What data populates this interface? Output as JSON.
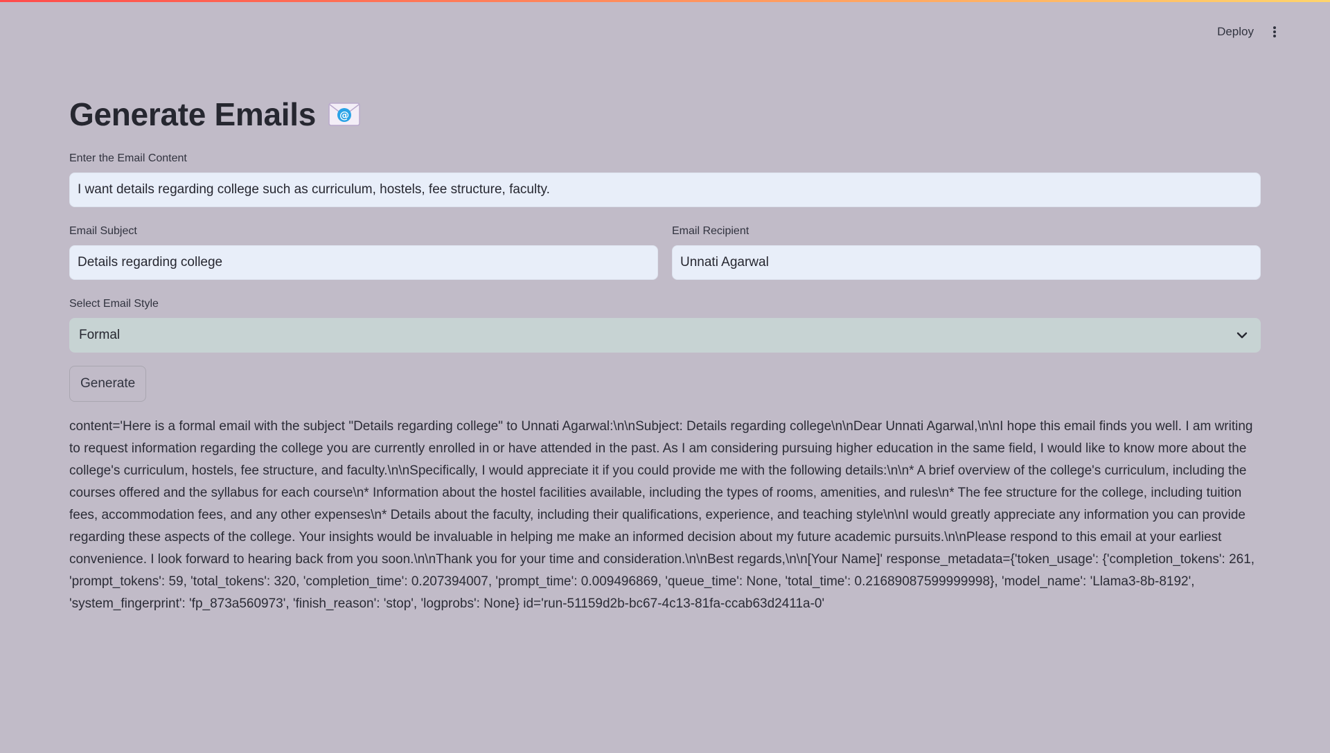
{
  "header": {
    "deploy_label": "Deploy",
    "menu_icon": "kebab-vertical-icon"
  },
  "page": {
    "title": "Generate Emails",
    "title_icon": "incoming-envelope-icon"
  },
  "form": {
    "content": {
      "label": "Enter the Email Content",
      "value": "I want details regarding college such as curriculum, hostels, fee structure, faculty."
    },
    "subject": {
      "label": "Email Subject",
      "value": "Details regarding college"
    },
    "recipient": {
      "label": "Email Recipient",
      "value": "Unnati Agarwal"
    },
    "style": {
      "label": "Select Email Style",
      "selected": "Formal"
    },
    "generate_label": "Generate"
  },
  "output": {
    "text": "content='Here is a formal email with the subject \"Details regarding college\" to Unnati Agarwal:\\n\\nSubject: Details regarding college\\n\\nDear Unnati Agarwal,\\n\\nI hope this email finds you well. I am writing to request information regarding the college you are currently enrolled in or have attended in the past. As I am considering pursuing higher education in the same field, I would like to know more about the college's curriculum, hostels, fee structure, and faculty.\\n\\nSpecifically, I would appreciate it if you could provide me with the following details:\\n\\n* A brief overview of the college's curriculum, including the courses offered and the syllabus for each course\\n* Information about the hostel facilities available, including the types of rooms, amenities, and rules\\n* The fee structure for the college, including tuition fees, accommodation fees, and any other expenses\\n* Details about the faculty, including their qualifications, experience, and teaching style\\n\\nI would greatly appreciate any information you can provide regarding these aspects of the college. Your insights would be invaluable in helping me make an informed decision about my future academic pursuits.\\n\\nPlease respond to this email at your earliest convenience. I look forward to hearing back from you soon.\\n\\nThank you for your time and consideration.\\n\\nBest regards,\\n\\n[Your Name]' response_metadata={'token_usage': {'completion_tokens': 261, 'prompt_tokens': 59, 'total_tokens': 320, 'completion_time': 0.207394007, 'prompt_time': 0.009496869, 'queue_time': None, 'total_time': 0.21689087599999998}, 'model_name': 'Llama3-8b-8192', 'system_fingerprint': 'fp_873a560973', 'finish_reason': 'stop', 'logprobs': None} id='run-51159d2b-bc67-4c13-81fa-ccab63d2411a-0'"
  },
  "colors": {
    "background": "#c1bbc8",
    "input_background": "#e8eef9",
    "select_background": "#c7d3d3",
    "text": "#262730"
  }
}
